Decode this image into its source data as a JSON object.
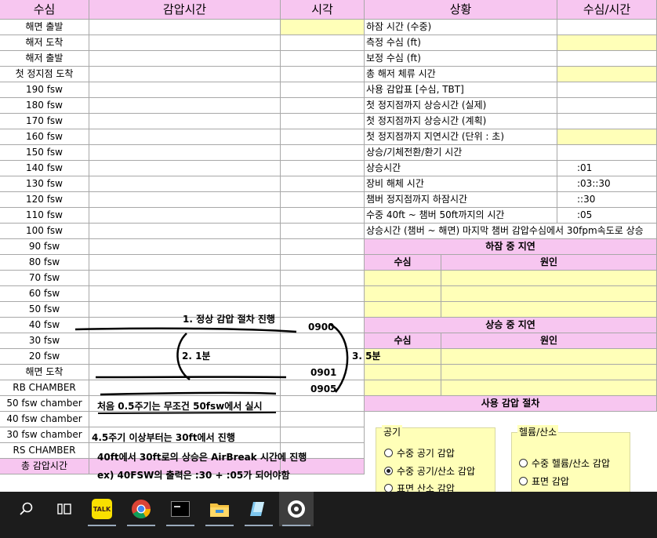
{
  "headers": {
    "col1": "수심",
    "col2": "감압시간",
    "col3": "시각",
    "col4": "상황",
    "col5": "수심/시간"
  },
  "left_rows": [
    "해면 출발",
    "해저 도착",
    "해저 출발",
    "첫 정지점 도착",
    "190 fsw",
    "180 fsw",
    "170 fsw",
    "160 fsw",
    "150 fsw",
    "140 fsw",
    "130 fsw",
    "120 fsw",
    "110 fsw",
    "100 fsw",
    "90 fsw",
    "80 fsw",
    "70 fsw",
    "60 fsw",
    "50 fsw",
    "40 fsw",
    "30 fsw",
    "20 fsw",
    "해면 도착",
    "RB CHAMBER",
    "50 fsw chamber",
    "40 fsw chamber",
    "30 fsw chamber",
    "RS CHAMBER",
    "총 감압시간"
  ],
  "situation_rows": [
    {
      "label": "하잠 시간 (수중)",
      "value": ""
    },
    {
      "label": "측정 수심 (ft)",
      "value": ""
    },
    {
      "label": "보정 수심 (ft)",
      "value": ""
    },
    {
      "label": "총 해저 체류 시간",
      "value": ""
    },
    {
      "label": "사용 감압표 [수심, TBT]",
      "value": ""
    },
    {
      "label": "첫 정지점까지 상승시간 (실제)",
      "value": ""
    },
    {
      "label": "첫 정지점까지 상승시간 (계획)",
      "value": ""
    },
    {
      "label": "첫 정지점까지 지연시간 (단위 : 초)",
      "value": ""
    },
    {
      "label": "상승/기체전환/환기 시간",
      "value": ""
    },
    {
      "label": "상승시간",
      "value": ":01"
    },
    {
      "label": "장비 해체 시간",
      "value": ":03::30"
    },
    {
      "label": "챔버 정지점까지 하잠시간",
      "value": "::30"
    },
    {
      "label": "수중 40ft ~ 챔버 50ft까지의 시간",
      "value": ":05"
    },
    {
      "label": "상승시간 (챔버 ~ 해면) 마지막 챔버 감압수심에서 30fpm속도로 상승",
      "value": ""
    }
  ],
  "descent_delay": {
    "title": "하잠 중 지연",
    "depth_label": "수심",
    "cause_label": "원인"
  },
  "ascent_delay": {
    "title": "상승 중 지연",
    "depth_label": "수심",
    "cause_label": "원인",
    "first_value": "3. 5분"
  },
  "procedure_header": "사용 감압 절차",
  "air_group": {
    "title": "공기",
    "options": [
      {
        "label": "수중 공기 감압",
        "selected": false
      },
      {
        "label": "수중 공기/산소 감압",
        "selected": true
      },
      {
        "label": "표면 산소 감압",
        "selected": false
      }
    ]
  },
  "helox_group": {
    "title": "헬륨/산소",
    "options": [
      {
        "label": "수중 헬륨/산소 감압",
        "selected": false
      },
      {
        "label": "표면 감압",
        "selected": false
      }
    ]
  },
  "annotations": {
    "a1": "1. 정상 감압 절차 진행",
    "t0900": "0900",
    "a2": "2. 1분",
    "t0901": "0901",
    "t0905": "0905",
    "a3": "처음 0.5주기는 무조건 50fsw에서 실시",
    "a4": "4.5주기 이상부터는 30ft에서 진행",
    "a5": "40ft에서 30ft로의 상승은 AirBreak 시간에 진행",
    "a6": "ex) 40FSW의 출력은 :30 + :05가 되어야함"
  },
  "taskbar": {
    "icons": [
      "search-icon",
      "task-view-icon",
      "kakaotalk-icon",
      "chrome-icon",
      "terminal-icon",
      "file-explorer-icon",
      "notepad-icon",
      "app-icon"
    ],
    "kakao_text": "TALK"
  },
  "colors": {
    "pink": "#f7c6f0",
    "yellow": "#ffffb8",
    "taskbar": "#1c1c1c"
  }
}
